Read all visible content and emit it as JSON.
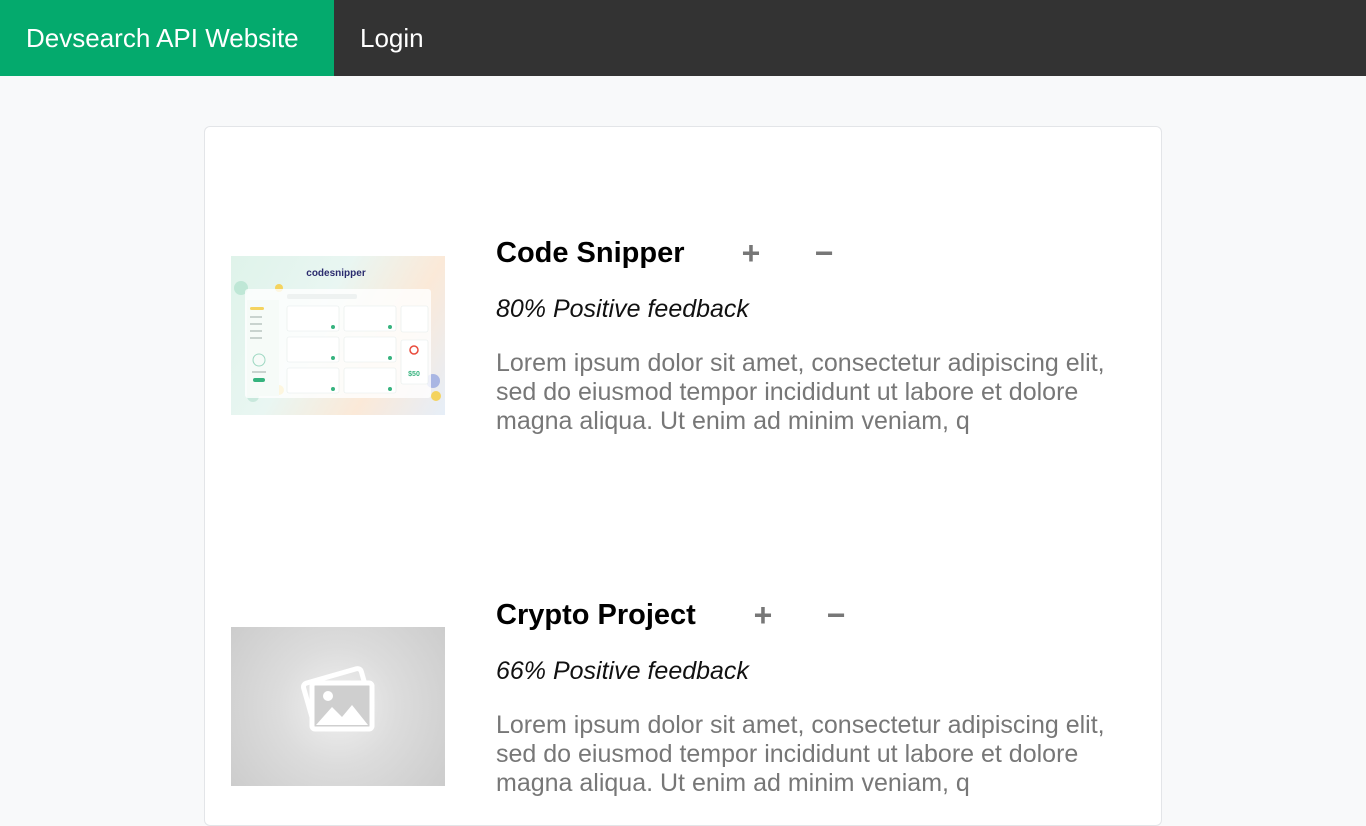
{
  "navbar": {
    "brand": "Devsearch API Website",
    "login": "Login"
  },
  "colors": {
    "brand_bg": "#04aa6d",
    "navbar_bg": "#333333",
    "page_bg": "#f8f9fa"
  },
  "projects": [
    {
      "title": "Code Snipper",
      "upvote_label": "+",
      "downvote_label": "−",
      "feedback": "80% Positive feedback",
      "description": "Lorem ipsum dolor sit amet, consectetur adipiscing elit, sed do eiusmod tempor incididunt ut labore et dolore magna aliqua. Ut enim ad minim veniam, q",
      "thumbnail": {
        "logo_text": "codesnipper",
        "price_text": "$50"
      }
    },
    {
      "title": "Crypto Project",
      "upvote_label": "+",
      "downvote_label": "−",
      "feedback": "66% Positive feedback",
      "description": "Lorem ipsum dolor sit amet, consectetur adipiscing elit, sed do eiusmod tempor incididunt ut labore et dolore magna aliqua. Ut enim ad minim veniam, q",
      "thumbnail": {
        "icon": "image-placeholder-icon"
      }
    }
  ]
}
